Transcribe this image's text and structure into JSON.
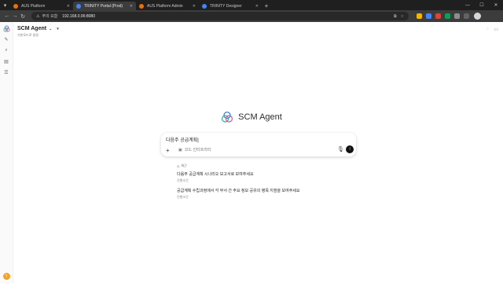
{
  "browser": {
    "tabs": [
      {
        "title": "AUS Platform",
        "color": "#e8710a"
      },
      {
        "title": "TRINITY Portal (Prod)",
        "color": "#4285f4"
      },
      {
        "title": "AUS Platform Admin",
        "color": "#e8710a"
      },
      {
        "title": "TRINITY Designer",
        "color": "#4285f4"
      }
    ],
    "active_tab": 1,
    "address": {
      "security_label": "주의 요함",
      "url": "192.168.0.96:8080"
    }
  },
  "app": {
    "agent_name": "SCM Agent",
    "agent_subtitle": "기본모드로 설정",
    "hero_title": "SCM Agent",
    "prompt": {
      "value": "다음주 공급계획|",
      "chip_label": "코드 인터프리터"
    },
    "recent": {
      "label": "최근",
      "items": [
        {
          "text": "다음주 공급계획 시나리오 보고서로 보여주세요",
          "meta": "진행조건"
        },
        {
          "text": "공급계획 수립과정에서 각 부서 간 주요 정보 공유의 병목 지점을 보여주세요",
          "meta": "진행조건"
        }
      ]
    },
    "avatar_letter": "T"
  },
  "colors": {
    "brand_teal": "#2bb3a3",
    "brand_blue": "#3a7bd5",
    "brand_pink": "#e05a8a"
  }
}
